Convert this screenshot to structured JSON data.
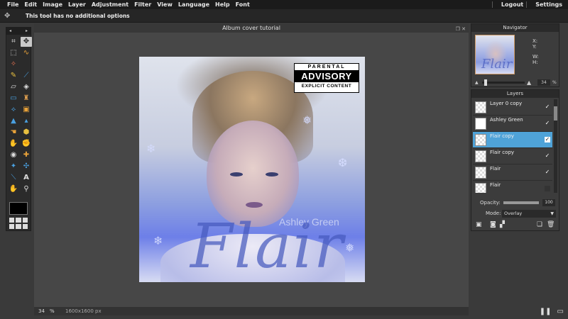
{
  "menu": {
    "items": [
      "File",
      "Edit",
      "Image",
      "Layer",
      "Adjustment",
      "Filter",
      "View",
      "Language",
      "Help",
      "Font"
    ],
    "logout": "Logout",
    "settings": "Settings"
  },
  "options": {
    "message": "This tool has no additional options"
  },
  "document": {
    "title": "Album cover tutorial",
    "zoom": "34",
    "zoom_unit": "%",
    "size": "1600x1600 px"
  },
  "artwork": {
    "advisory_line1": "PARENTAL",
    "advisory_line2": "ADVISORY",
    "advisory_line3": "EXPLICIT CONTENT",
    "artist": "Ashley Green",
    "album": "Flair"
  },
  "navigator": {
    "title": "Navigator",
    "x_label": "X:",
    "y_label": "Y:",
    "w_label": "W:",
    "h_label": "H:",
    "zoom": "34",
    "zoom_unit": "%"
  },
  "layers": {
    "title": "Layers",
    "items": [
      {
        "name": "Layer 0 copy",
        "visible": true,
        "selected": false
      },
      {
        "name": "Ashley Green",
        "visible": true,
        "selected": false
      },
      {
        "name": "Flair copy",
        "visible": true,
        "selected": true
      },
      {
        "name": "Flair copy",
        "visible": true,
        "selected": false
      },
      {
        "name": "Flair",
        "visible": true,
        "selected": false
      },
      {
        "name": "Flair",
        "visible": false,
        "selected": false
      }
    ],
    "opacity_label": "Opacity:",
    "opacity_value": "100",
    "mode_label": "Mode:",
    "mode_value": "Overlay"
  },
  "colors": {
    "selected_layer": "#4fa3d8",
    "menubar": "#1b1b1b",
    "workspace": "#474747"
  }
}
